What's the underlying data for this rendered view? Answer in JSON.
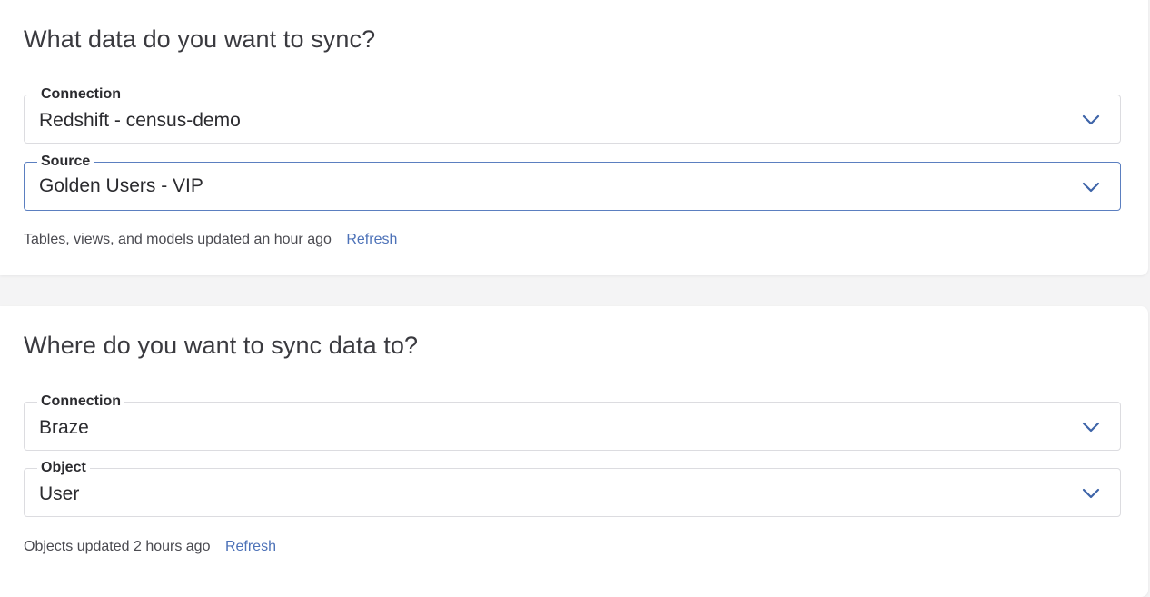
{
  "source_section": {
    "title": "What data do you want to sync?",
    "connection": {
      "label": "Connection",
      "value": "Redshift - census-demo"
    },
    "source": {
      "label": "Source",
      "value": "Golden Users - VIP"
    },
    "status_text": "Tables, views, and models updated an hour ago",
    "refresh_label": "Refresh"
  },
  "destination_section": {
    "title": "Where do you want to sync data to?",
    "connection": {
      "label": "Connection",
      "value": "Braze"
    },
    "object": {
      "label": "Object",
      "value": "User"
    },
    "status_text": "Objects updated 2 hours ago",
    "refresh_label": "Refresh"
  },
  "icons": {
    "dropdown": "chevron-down-icon"
  },
  "colors": {
    "accent": "#4d72b8",
    "focus_border": "#5b7fc0",
    "chevron": "#3e64a8"
  }
}
